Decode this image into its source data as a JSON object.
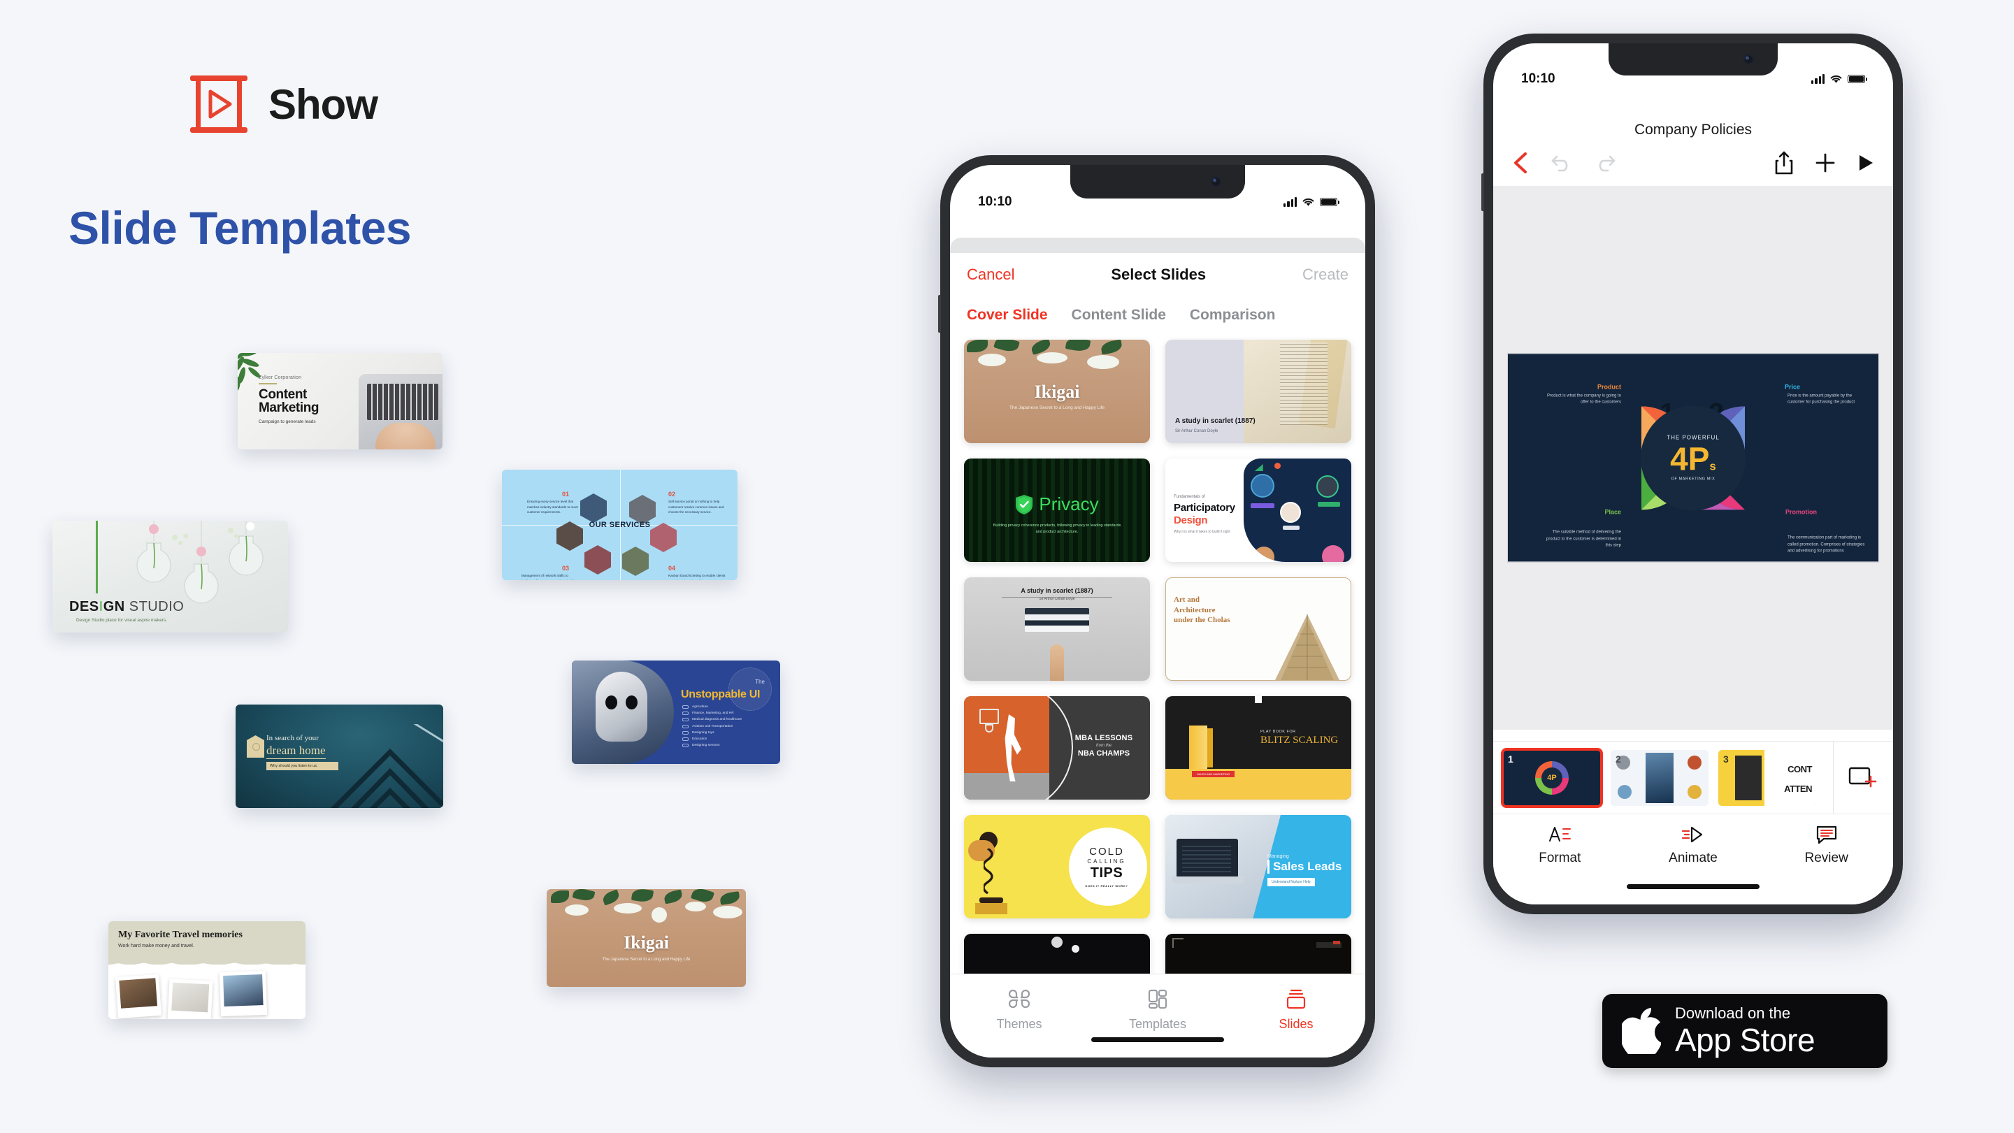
{
  "brand": {
    "name": "Show",
    "logo_icon": "play-frame-icon",
    "accent": "#e8432f"
  },
  "headline": {
    "text": "Slide Templates",
    "color": "#2e52a8"
  },
  "gallery": {
    "cards": [
      {
        "id": "content-marketing",
        "corp": "Zylker Corporation",
        "title_line1": "Content",
        "title_line2": "Marketing",
        "subtitle": "Campaign to generate leads"
      },
      {
        "id": "design-studio",
        "title_bold": "DES",
        "title_accent": "I",
        "title_bold2": "GN",
        "title_thin": " STUDIO",
        "subtitle": "Design Studio place for visual aspire makers."
      },
      {
        "id": "our-services",
        "center": "OUR SERVICES",
        "items": [
          {
            "num": "01",
            "text": "Ensuring every service level that matches industry standards to meet customer requirements."
          },
          {
            "num": "02",
            "text": "Self service portal or nothing to help customers resolve common issues and choose the necessary service."
          },
          {
            "num": "03",
            "text": "Management of network traffic to facilitate effective usage of bandwidth, avoiding data latency."
          },
          {
            "num": "04",
            "text": "Kanban board ticketing to enable clients to track and monitor all the requests at work items in one."
          }
        ]
      },
      {
        "id": "dream-home",
        "line1": "In search of your",
        "line2": "dream home",
        "tag": "Why should you listen to us."
      },
      {
        "id": "unstoppable-ui",
        "the": "The",
        "title": "Unstoppable UI",
        "bullets": [
          "Agriculture",
          "Finance, Marketing, and HR",
          "Medical diagnosis and healthcare",
          "Aviation and Transportation",
          "Designing toys",
          "Education",
          "Designing sensors"
        ]
      },
      {
        "id": "travel-memories",
        "title": "My Favorite Travel memories",
        "subtitle": "Work hard make money and travel."
      },
      {
        "id": "ikigai",
        "title": "Ikigai",
        "subtitle": "The Japanese Secret to a Long and Happy Life"
      }
    ]
  },
  "phone_select": {
    "status": {
      "time": "10:10",
      "signal_icon": "signal-bars-icon",
      "wifi_icon": "wifi-icon",
      "battery_icon": "battery-full-icon"
    },
    "nav": {
      "cancel": "Cancel",
      "title": "Select Slides",
      "create": "Create"
    },
    "segments": [
      {
        "label": "Cover Slide",
        "active": true
      },
      {
        "label": "Content Slide",
        "active": false
      },
      {
        "label": "Comparison",
        "active": false
      }
    ],
    "thumbnails": [
      {
        "id": "ikigai",
        "title": "Ikigai",
        "subtitle": "The Japanese Secret to a Long and Happy Life"
      },
      {
        "id": "study-in-scarlet-book",
        "title": "A study in scarlet (1887)",
        "subtitle": "Sir Arthur Conan Doyle"
      },
      {
        "id": "privacy",
        "title": "Privacy",
        "subtitle": "Building privacy coherence products, following privacy in leading standards and product architecture."
      },
      {
        "id": "participatory-design",
        "kicker": "Fundamentals of",
        "title": "Participatory",
        "title2": "Design",
        "subtitle": "Why it is what it takes to build it right"
      },
      {
        "id": "study-in-scarlet-hand",
        "title": "A study in scarlet (1887)",
        "subtitle": "Sir Arthur Conan Doyle"
      },
      {
        "id": "art-architecture-cholas",
        "title_line1": "Art and",
        "title_line2": "Architecture",
        "title_line3": "under the Cholas"
      },
      {
        "id": "mba-lessons",
        "title": "MBA LESSONS",
        "mid": "from the",
        "title2": "NBA CHAMPS"
      },
      {
        "id": "blitz-scaling",
        "kicker": "PLAY BOOK FOR",
        "title": "BLITZ SCALING",
        "badge": "SALES AND MARKETING"
      },
      {
        "id": "cold-calling-tips",
        "title_line1": "COLD",
        "title_line2": "CALLING",
        "title_line3": "TIPS",
        "subtitle": "DOES IT REALLY WORK?"
      },
      {
        "id": "sales-leads",
        "kicker": "Managing",
        "title": "Sales Leads",
        "subtitle": "Understand Nurture Help"
      },
      {
        "id": "dark-slide-left",
        "title": ""
      },
      {
        "id": "dark-slide-right",
        "title": ""
      }
    ],
    "tabs": [
      {
        "label": "Themes",
        "icon": "clover-grid-icon",
        "active": false
      },
      {
        "label": "Templates",
        "icon": "layout-grid-icon",
        "active": false
      },
      {
        "label": "Slides",
        "icon": "slides-stack-icon",
        "active": true
      }
    ]
  },
  "phone_editor": {
    "status": {
      "time": "10:10",
      "signal_icon": "signal-bars-icon",
      "wifi_icon": "wifi-icon",
      "battery_icon": "battery-full-icon"
    },
    "title": "Company Policies",
    "toolbar": [
      {
        "name": "back-button",
        "icon": "chevron-left-icon",
        "color": "#e8352a",
        "enabled": true
      },
      {
        "name": "undo-button",
        "icon": "undo-arrow-icon",
        "color": "#d5d6d8",
        "enabled": false
      },
      {
        "name": "redo-button",
        "icon": "redo-arrow-icon",
        "color": "#d5d6d8",
        "enabled": false
      },
      {
        "name": "share-button",
        "icon": "share-upload-icon",
        "color": "#111111",
        "enabled": true
      },
      {
        "name": "add-button",
        "icon": "plus-icon",
        "color": "#111111",
        "enabled": true
      },
      {
        "name": "present-button",
        "icon": "play-triangle-icon",
        "color": "#111111",
        "enabled": true
      }
    ],
    "slide": {
      "center_kicker": "THE POWERFUL",
      "center_title": "4P",
      "center_title_sub": "s",
      "center_footer": "OF MARKETING MIX",
      "quadrants": [
        {
          "num": "1",
          "label": "Product",
          "label_color": "#f08a3c",
          "text": "Product is what the company is going to offer to the customers",
          "colors": [
            "#f2633c",
            "#f7a85a"
          ]
        },
        {
          "num": "2",
          "label": "Price",
          "label_color": "#34b7e8",
          "text": "Price is the amount payable by the customer for purchasing the product",
          "colors": [
            "#5f62bb",
            "#6f8fd8"
          ]
        },
        {
          "num": "3",
          "label": "Place",
          "label_color": "#7cc14a",
          "text": "The suitable method of delivering the product to the customer is determined in this step",
          "colors": [
            "#4cae3e",
            "#a9dd6a"
          ]
        },
        {
          "num": "4",
          "label": "Promotion",
          "label_color": "#e8457f",
          "text": "The communication part of marketing is called promotion. Comprises of strategies and advertising for promotions",
          "colors": [
            "#e8397a",
            "#c25ab5"
          ]
        }
      ]
    },
    "filmstrip": [
      {
        "num": "1",
        "selected": true,
        "id": "four-ps-marketing-mix"
      },
      {
        "num": "2",
        "selected": false,
        "id": "brand-projects"
      },
      {
        "num": "3",
        "selected": false,
        "id": "content-attention"
      }
    ],
    "add_slide_icon": "add-slide-icon",
    "tabs": [
      {
        "label": "Format",
        "icon": "format-text-icon"
      },
      {
        "label": "Animate",
        "icon": "animate-arrow-icon"
      },
      {
        "label": "Review",
        "icon": "review-comment-icon"
      }
    ]
  },
  "app_store_badge": {
    "icon": "apple-logo-icon",
    "small": "Download on the",
    "big": "App Store"
  }
}
